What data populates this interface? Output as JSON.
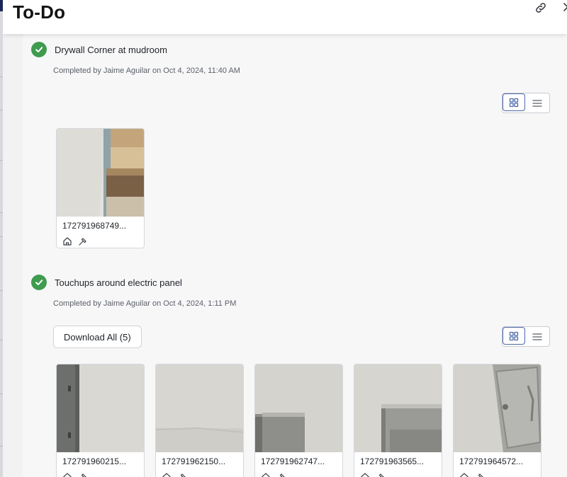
{
  "header": {
    "title": "To-Do",
    "link_icon": "link-icon",
    "close_icon": "close-icon"
  },
  "items": [
    {
      "title": "Drywall Corner at mudroom",
      "meta": "Completed by Jaime Aguilar on Oct 4, 2024, 11:40 AM",
      "photos": [
        {
          "name": "172791968749..."
        }
      ]
    },
    {
      "title": "Touchups around electric panel",
      "meta": "Completed by Jaime Aguilar on Oct 4, 2024, 1:11 PM",
      "download_label": "Download All (5)",
      "photos": [
        {
          "name": "172791960215..."
        },
        {
          "name": "172791962150..."
        },
        {
          "name": "172791962747..."
        },
        {
          "name": "172791963565..."
        },
        {
          "name": "172791964572..."
        }
      ]
    }
  ],
  "colors": {
    "check": "#3f9b4e",
    "accent": "#4b67a8",
    "panel_bg": "#f7f7f8"
  }
}
